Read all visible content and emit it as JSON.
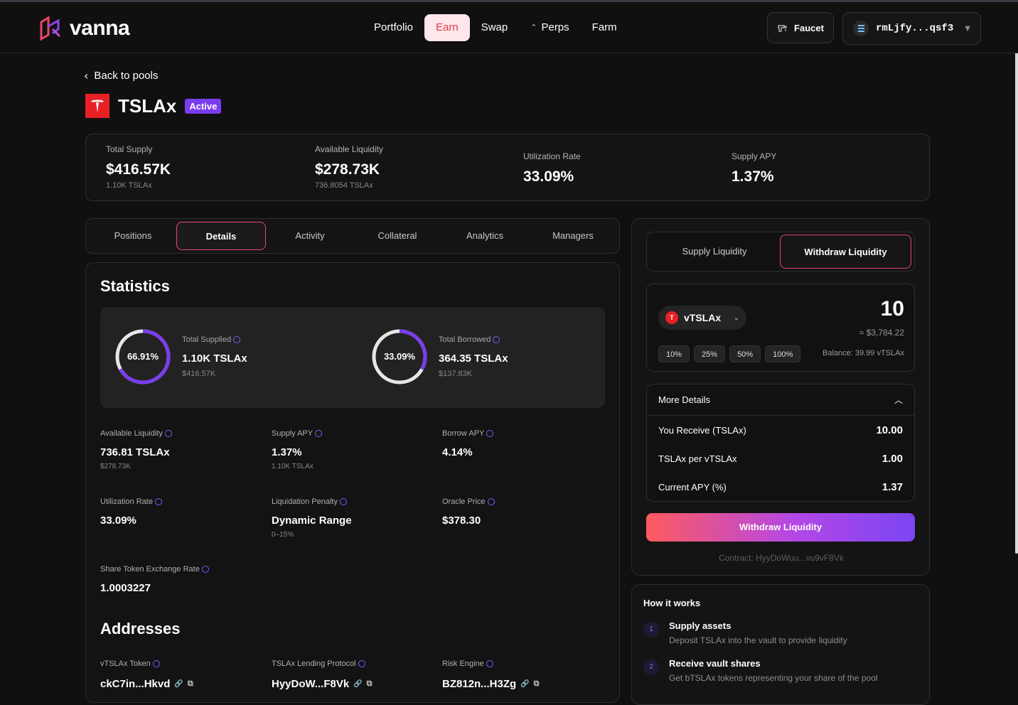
{
  "app": {
    "brand": "vanna"
  },
  "nav": {
    "links": [
      {
        "label": "Portfolio"
      },
      {
        "label": "Earn"
      },
      {
        "label": "Swap"
      },
      {
        "label": "Perps"
      },
      {
        "label": "Farm"
      }
    ],
    "active": "Earn",
    "faucet_label": "Faucet",
    "wallet_address": "rmLjfy...qsf3"
  },
  "back_label": "Back to pools",
  "pool": {
    "name": "TSLAx",
    "status": "Active"
  },
  "summary": {
    "total_supply": {
      "label": "Total Supply",
      "value": "$416.57K",
      "sub": "1.10K TSLAx"
    },
    "available_liquidity": {
      "label": "Available Liquidity",
      "value": "$278.73K",
      "sub": "736.8054 TSLAx"
    },
    "utilization_rate": {
      "label": "Utilization Rate",
      "value": "33.09%"
    },
    "supply_apy": {
      "label": "Supply APY",
      "value": "1.37%"
    }
  },
  "tabs": [
    "Positions",
    "Details",
    "Activity",
    "Collateral",
    "Analytics",
    "Managers"
  ],
  "active_tab": "Details",
  "statistics": {
    "title": "Statistics",
    "supplied": {
      "percent_label": "66.91%",
      "fraction": 0.6691,
      "label": "Total Supplied",
      "value": "1.10K TSLAx",
      "sub": "$416.57K"
    },
    "borrowed": {
      "percent_label": "33.09%",
      "fraction": 0.3309,
      "label": "Total Borrowed",
      "value": "364.35 TSLAx",
      "sub": "$137.83K"
    },
    "metrics": [
      {
        "label": "Available Liquidity",
        "value": "736.81 TSLAx",
        "sub": "$278.73K"
      },
      {
        "label": "Supply APY",
        "value": "1.37%",
        "sub": "1.10K TSLAx"
      },
      {
        "label": "Borrow APY",
        "value": "4.14%",
        "sub": ""
      },
      {
        "label": "Utilization Rate",
        "value": "33.09%",
        "sub": ""
      },
      {
        "label": "Liquidation Penalty",
        "value": "Dynamic Range",
        "sub": "0–15%"
      },
      {
        "label": "Oracle Price",
        "value": "$378.30",
        "sub": ""
      },
      {
        "label": "Share Token Exchange Rate",
        "value": "1.0003227",
        "sub": ""
      }
    ]
  },
  "addresses": {
    "title": "Addresses",
    "items": [
      {
        "label": "vTSLAx Token",
        "value": "ckC7in...Hkvd"
      },
      {
        "label": "TSLAx Lending Protocol",
        "value": "HyyDoW...F8Vk"
      },
      {
        "label": "Risk Engine",
        "value": "BZ812n...H3Zg"
      }
    ]
  },
  "panel": {
    "modes": [
      "Supply Liquidity",
      "Withdraw Liquidity"
    ],
    "active_mode": "Withdraw Liquidity",
    "token": "vTSLAx",
    "amount": "10",
    "usd_value": "≈ $3,784.22",
    "percent_buttons": [
      "10%",
      "25%",
      "50%",
      "100%"
    ],
    "balance": "Balance: 39.99 vTSLAx",
    "more_details": {
      "title": "More Details",
      "rows": [
        {
          "label": "You Receive (TSLAx)",
          "value": "10.00"
        },
        {
          "label": "TSLAx per vTSLAx",
          "value": "1.00"
        },
        {
          "label": "Current APY (%)",
          "value": "1.37"
        }
      ]
    },
    "action_label": "Withdraw Liquidity",
    "contract": "Contract: HyyDoWuu...vu9vF8Vk"
  },
  "how_it_works": {
    "title": "How it works",
    "steps": [
      {
        "num": "1",
        "title": "Supply assets",
        "desc": "Deposit TSLAx into the vault to provide liquidity"
      },
      {
        "num": "2",
        "title": "Receive vault shares",
        "desc": "Get bTSLAx tokens representing your share of the pool"
      }
    ]
  },
  "colors": {
    "accent": "#7a3cf0",
    "earn_active_bg": "#fde7ea",
    "earn_active_text": "#e8394d",
    "tab_border": "#e8456c",
    "tesla_red": "#e82127"
  }
}
